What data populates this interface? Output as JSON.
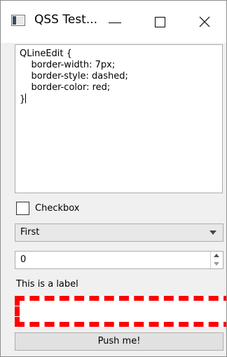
{
  "window": {
    "title": "QSS Test...",
    "icon": "app-window-icon",
    "controls": [
      "minimize-icon",
      "maximize-icon",
      "close-icon"
    ]
  },
  "editor": {
    "lines": [
      "QLineEdit {",
      "    border-width: 7px;",
      "    border-style: dashed;",
      "    border-color: red;",
      "}"
    ]
  },
  "checkbox": {
    "label": "Checkbox",
    "checked": false
  },
  "combo": {
    "value": "First"
  },
  "spinbox": {
    "value": "0"
  },
  "label": {
    "text": "This is a label"
  },
  "line_edit": {
    "value": "",
    "border_color": "#ff0000"
  },
  "button": {
    "label": "Push me!"
  }
}
